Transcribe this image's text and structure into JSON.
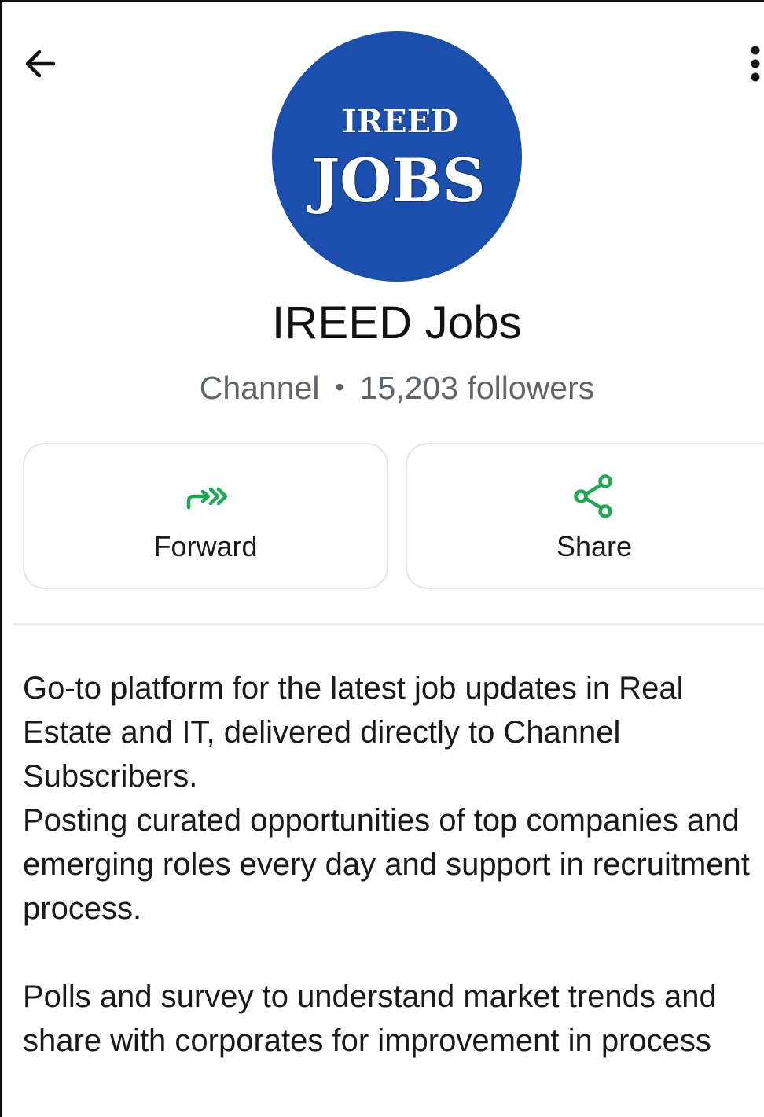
{
  "header": {
    "back_icon": "arrow-left-icon",
    "more_icon": "more-vertical-icon"
  },
  "avatar": {
    "line1": "IREED",
    "line2": "JOBS",
    "background": "#1a4fae"
  },
  "channel": {
    "name": "IREED Jobs",
    "type": "Channel",
    "followers": "15,203 followers"
  },
  "actions": {
    "forward": {
      "label": "Forward",
      "icon": "forward-icon"
    },
    "share": {
      "label": "Share",
      "icon": "share-icon"
    },
    "icon_color": "#1da851"
  },
  "description": {
    "line1": "Go-to platform for the latest job updates in Real Estate and IT, delivered directly to Channel Subscribers.",
    "line2": "Posting curated opportunities of top companies and emerging roles every day and support in recruitment process.",
    "line3": "Polls and survey to understand market trends and share with corporates for improvement in process"
  }
}
